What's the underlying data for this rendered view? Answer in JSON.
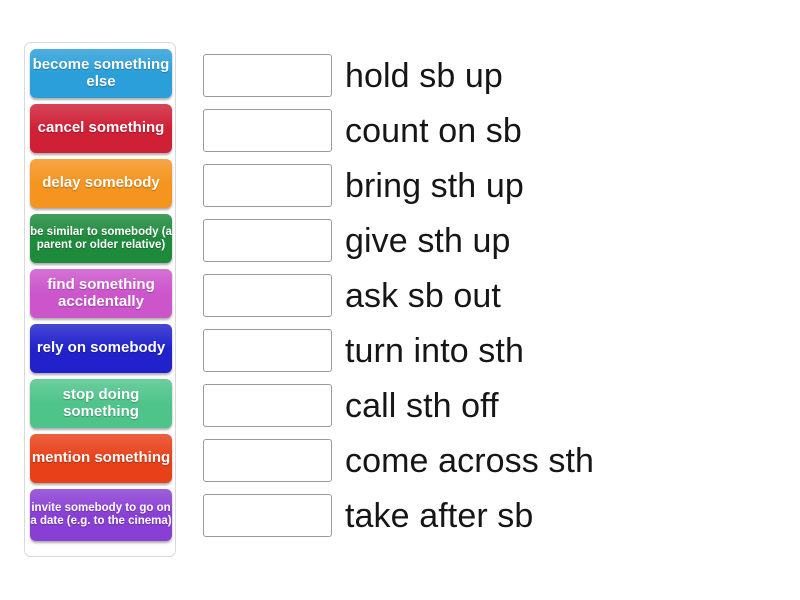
{
  "activity": {
    "type": "match-up",
    "left_panel": {
      "name": "definitions-bank",
      "tiles": [
        {
          "label": "become something else",
          "lines": 2,
          "color": "#2b9fd9"
        },
        {
          "label": "cancel something",
          "lines": 2,
          "color": "#cf2036"
        },
        {
          "label": "delay somebody",
          "lines": 2,
          "color": "#f5941f"
        },
        {
          "label": "be similar to somebody (a parent or older relative)",
          "lines": 3,
          "color": "#1e8a3c"
        },
        {
          "label": "find something accidentally",
          "lines": 2,
          "color": "#cc55cc"
        },
        {
          "label": "rely on somebody",
          "lines": 2,
          "color": "#2222cc"
        },
        {
          "label": "stop doing something",
          "lines": 2,
          "color": "#4ec48a"
        },
        {
          "label": "mention something",
          "lines": 2,
          "color": "#e8411a"
        },
        {
          "label": "invite somebody to go on a date (e.g. to the cinema)",
          "lines": 3,
          "color": "#8a3fd4"
        }
      ]
    },
    "right_panel": {
      "name": "phrasal-verb-rows",
      "rows": [
        {
          "dropzone_value": "",
          "phrase": "hold sb up"
        },
        {
          "dropzone_value": "",
          "phrase": "count on sb"
        },
        {
          "dropzone_value": "",
          "phrase": "bring sth up"
        },
        {
          "dropzone_value": "",
          "phrase": "give sth up"
        },
        {
          "dropzone_value": "",
          "phrase": "ask sb out"
        },
        {
          "dropzone_value": "",
          "phrase": "turn into sth"
        },
        {
          "dropzone_value": "",
          "phrase": "call sth off"
        },
        {
          "dropzone_value": "",
          "phrase": "come across sth"
        },
        {
          "dropzone_value": "",
          "phrase": "take after sb"
        }
      ]
    }
  }
}
